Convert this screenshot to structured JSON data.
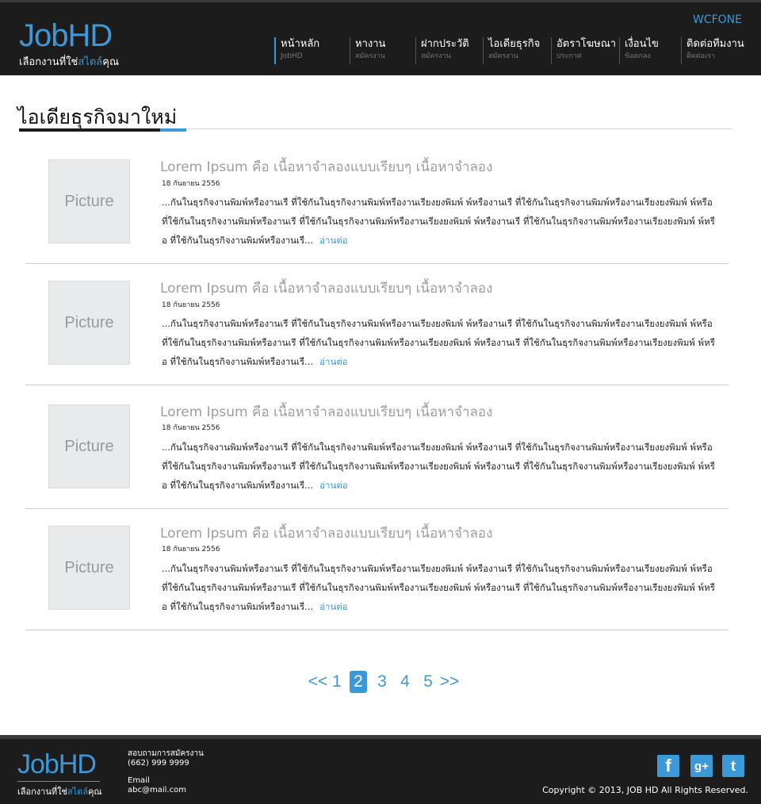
{
  "header": {
    "logo": "JobHD",
    "tagline_pre": "เลือกงานที่ใช่",
    "tagline_accent": "สไตล์",
    "tagline_post": "คุณ",
    "user": "WCFONE",
    "nav": [
      {
        "label": "หน้าหลัก",
        "sub": "JobHD"
      },
      {
        "label": "หางาน",
        "sub": "สมัครงาน"
      },
      {
        "label": "ฝากประวัติ",
        "sub": "สมัครงาน"
      },
      {
        "label": "ไอเดียธุรกิจ",
        "sub": "สมัครงาน"
      },
      {
        "label": "อัตราโฆษณา",
        "sub": "ประกาศ"
      },
      {
        "label": "เงื่อนไข",
        "sub": "ข้อตกลง"
      },
      {
        "label": "ติดต่อทีมงาน",
        "sub": "ติดต่อเรา"
      }
    ]
  },
  "page_title": "ไอเดียธุรกิจมาใหม่",
  "articles": [
    {
      "thumb": "Picture",
      "title": "Lorem Ipsum คือ เนื้อหาจำลองแบบเรียบๆ เนื้อหาจำลอง",
      "date": "18 กันยายน 2556",
      "body": "...กันในธุรกิจงานพิมพ์หรืองานเรี ที่ใช้กันในธุรกิจงานพิมพ์หรืองานเรียงยงพิมพ์ พ์หรืองานเรี ที่ใช้กันในธุรกิจงานพิมพ์หรืองานเรียงยงพิมพ์ พ์หรือ ที่ใช้กันในธุรกิจงานพิมพ์หรืองานเรี ที่ใช้กันในธุรกิจงานพิมพ์หรืองานเรียงยงพิมพ์ พ์หรืองานเรี ที่ใช้กันในธุรกิจงานพิมพ์หรืองานเรียงยงพิมพ์ พ์หรือ ที่ใช้กันในธุรกิจงานพิมพ์หรืองานเรี...",
      "more": "อ่านต่อ"
    },
    {
      "thumb": "Picture",
      "title": "Lorem Ipsum คือ เนื้อหาจำลองแบบเรียบๆ เนื้อหาจำลอง",
      "date": "18 กันยายน 2556",
      "body": "...กันในธุรกิจงานพิมพ์หรืองานเรี ที่ใช้กันในธุรกิจงานพิมพ์หรืองานเรียงยงพิมพ์ พ์หรืองานเรี ที่ใช้กันในธุรกิจงานพิมพ์หรืองานเรียงยงพิมพ์ พ์หรือ ที่ใช้กันในธุรกิจงานพิมพ์หรืองานเรี ที่ใช้กันในธุรกิจงานพิมพ์หรืองานเรียงยงพิมพ์ พ์หรืองานเรี ที่ใช้กันในธุรกิจงานพิมพ์หรืองานเรียงยงพิมพ์ พ์หรือ ที่ใช้กันในธุรกิจงานพิมพ์หรืองานเรี...",
      "more": "อ่านต่อ"
    },
    {
      "thumb": "Picture",
      "title": "Lorem Ipsum คือ เนื้อหาจำลองแบบเรียบๆ เนื้อหาจำลอง",
      "date": "18 กันยายน 2556",
      "body": "...กันในธุรกิจงานพิมพ์หรืองานเรี ที่ใช้กันในธุรกิจงานพิมพ์หรืองานเรียงยงพิมพ์ พ์หรืองานเรี ที่ใช้กันในธุรกิจงานพิมพ์หรืองานเรียงยงพิมพ์ พ์หรือ ที่ใช้กันในธุรกิจงานพิมพ์หรืองานเรี ที่ใช้กันในธุรกิจงานพิมพ์หรืองานเรียงยงพิมพ์ พ์หรืองานเรี ที่ใช้กันในธุรกิจงานพิมพ์หรืองานเรียงยงพิมพ์ พ์หรือ ที่ใช้กันในธุรกิจงานพิมพ์หรืองานเรี...",
      "more": "อ่านต่อ"
    },
    {
      "thumb": "Picture",
      "title": "Lorem Ipsum คือ เนื้อหาจำลองแบบเรียบๆ เนื้อหาจำลอง",
      "date": "18 กันยายน 2556",
      "body": "...กันในธุรกิจงานพิมพ์หรืองานเรี ที่ใช้กันในธุรกิจงานพิมพ์หรืองานเรียงยงพิมพ์ พ์หรืองานเรี ที่ใช้กันในธุรกิจงานพิมพ์หรืองานเรียงยงพิมพ์ พ์หรือ ที่ใช้กันในธุรกิจงานพิมพ์หรืองานเรี ที่ใช้กันในธุรกิจงานพิมพ์หรืองานเรียงยงพิมพ์ พ์หรืองานเรี ที่ใช้กันในธุรกิจงานพิมพ์หรืองานเรียงยงพิมพ์ พ์หรือ ที่ใช้กันในธุรกิจงานพิมพ์หรืองานเรี...",
      "more": "อ่านต่อ"
    }
  ],
  "pagination": {
    "prev": "<<",
    "pages": [
      "1",
      "2",
      "3",
      "4",
      "5"
    ],
    "current": "2",
    "next": ">>"
  },
  "footer": {
    "logo": "JobHD",
    "tagline_pre": "เลือกงานที่ใช่",
    "tagline_accent": "สไตล์",
    "tagline_post": "คุณ",
    "contact_label": "สอบถามการสมัครงาน",
    "phone": "(662) 999 9999",
    "email_label": "Email",
    "email": "abc@mail.com",
    "social": [
      {
        "icon": "facebook-icon",
        "glyph": "f"
      },
      {
        "icon": "google-plus-icon",
        "glyph": "g+"
      },
      {
        "icon": "twitter-icon",
        "glyph": "t"
      }
    ],
    "copyright": "Copyright © 2013, JOB HD All Rights Reserved."
  }
}
